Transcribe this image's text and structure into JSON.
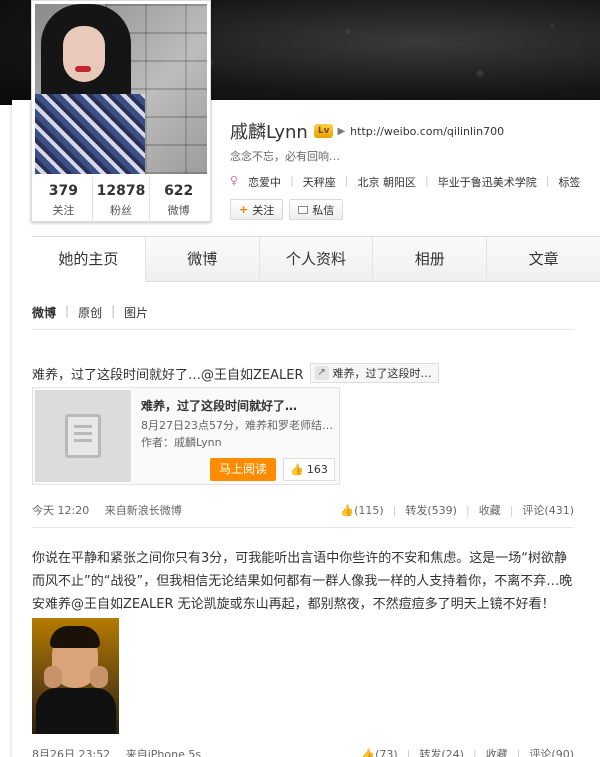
{
  "profile": {
    "name": "戚麟Lynn",
    "level_badge": "Lv",
    "url": "http://weibo.com/qilinlin700",
    "intro": "念念不忘，必有回响…",
    "tags": [
      "恋爱中",
      "天秤座",
      "北京 朝阳区",
      "毕业于鲁迅美术学院",
      "标签"
    ],
    "follow_label": "关注",
    "message_label": "私信",
    "stats": [
      {
        "num": "379",
        "label": "关注"
      },
      {
        "num": "12878",
        "label": "粉丝"
      },
      {
        "num": "622",
        "label": "微博"
      }
    ]
  },
  "tabs": [
    "她的主页",
    "微博",
    "个人资料",
    "相册",
    "文章"
  ],
  "active_tab": "她的主页",
  "subnav": [
    "微博",
    "原创",
    "图片"
  ],
  "post1": {
    "text": "难养，过了这段时间就好了…@王自如ZEALER",
    "chip": "难养，过了这段时…",
    "card": {
      "title": "难养，过了这段时间就好了…",
      "desc": "8月27日23点57分，难养和罗老师结…",
      "author": "作者：戚麟Lynn",
      "read_label": "马上阅读",
      "likes": "163"
    },
    "time": "今天 12:20",
    "source": "来自新浪长微博",
    "likes": "(115)",
    "repost": "转发(539)",
    "fav": "收藏",
    "comment": "评论(431)"
  },
  "post2": {
    "text": "你说在平静和紧张之间你只有3分，可我能听出言语中你些许的不安和焦虑。这是一场“树欲静而风不止”的“战役”，但我相信无论结果如何都有一群人像我一样的人支持着你，不离不弃…晚安难养@王自如ZEALER 无论凯旋或东山再起，都别熬夜，不然痘痘多了明天上镜不好看！",
    "time": "8月26日 23:52",
    "source": "来自iPhone 5s",
    "likes": "(73)",
    "repost": "转发(24)",
    "fav": "收藏",
    "comment": "评论(90)"
  }
}
